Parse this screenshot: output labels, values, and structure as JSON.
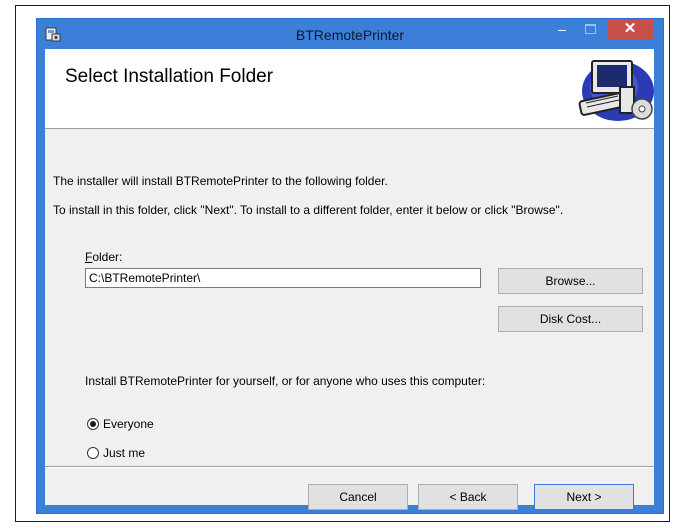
{
  "window": {
    "title": "BTRemotePrinter",
    "minimize_glyph": "–",
    "close_glyph": "✕"
  },
  "header": {
    "title": "Select Installation Folder"
  },
  "body": {
    "line1": "The installer will install BTRemotePrinter to the following folder.",
    "line2": "To install in this folder, click \"Next\". To install to a different folder, enter it below or click \"Browse\"."
  },
  "folder": {
    "label_access_key": "F",
    "label_rest": "older:",
    "value": "C:\\BTRemotePrinter\\"
  },
  "buttons": {
    "browse": "Browse...",
    "disk_cost": "Disk Cost...",
    "cancel": "Cancel",
    "back": "< Back",
    "next": "Next >"
  },
  "install_for": {
    "label": "Install BTRemotePrinter for yourself, or for anyone who uses this computer:",
    "options": [
      {
        "label": "Everyone",
        "checked": true
      },
      {
        "label": "Just me",
        "checked": false
      }
    ]
  },
  "colors": {
    "titlebar": "#3c7fd8",
    "close_button": "#c7504a"
  },
  "icons": [
    "installer-app-icon",
    "computer-disc-header-icon"
  ]
}
